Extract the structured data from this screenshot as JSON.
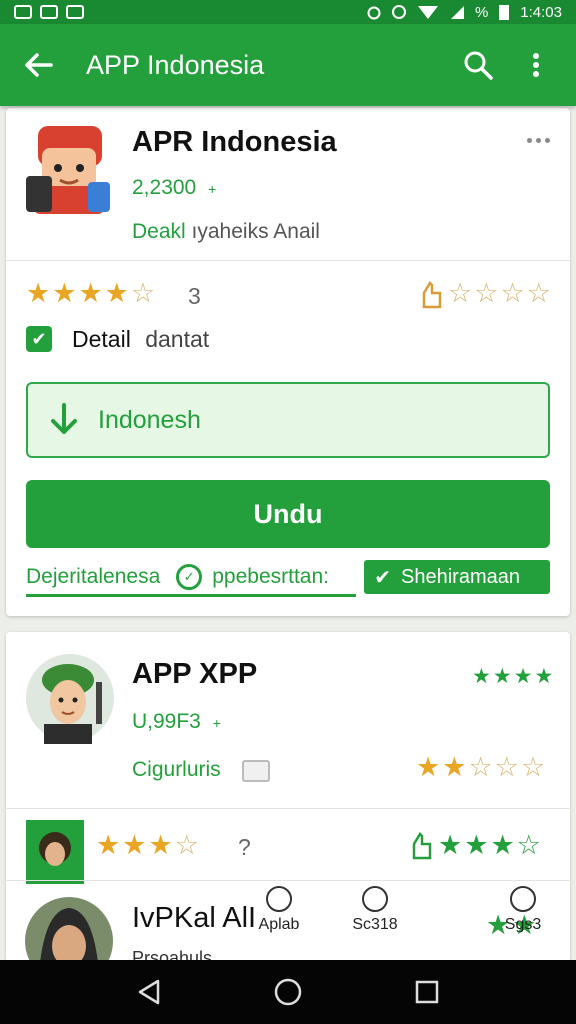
{
  "status_bar": {
    "battery": "%",
    "time": "1:4:03"
  },
  "app_bar": {
    "title": "APP Indonesia"
  },
  "card1": {
    "app_name": "APR Indonesia",
    "size": "2,2300",
    "size_suffix": "+",
    "dev_prefix": "Deakl",
    "dev_rest": "ıyaheiks Anail",
    "rating_count": "3",
    "detail_label": "Detail",
    "detail_rest": "dantat",
    "install_field_label": "Indonesh",
    "primary_button": "Undu",
    "info_left": "Dejeritalenesa",
    "info_middle": "ppebesrttan:",
    "info_pill": "Shehiramaan"
  },
  "card2": {
    "app_name": "APP XPP",
    "size": "U,99F3",
    "size_suffix": "+",
    "dev": "Cigurluris",
    "rating_count": "?",
    "third_app_name": "IvPKal AlI",
    "third_app_sub": "Prsoahuls"
  },
  "bottom_nav": {
    "item1": "Aplab",
    "item2": "Sc318",
    "item3": "Sgs3"
  },
  "icons": [
    "back-arrow-icon",
    "search-icon",
    "more-vert-icon",
    "download-icon",
    "check-icon",
    "star-icon",
    "thumb-icon",
    "home-icon",
    "back-triangle-icon",
    "recents-icon"
  ],
  "colors": {
    "primary": "#23a03c",
    "star": "#e9a524"
  }
}
